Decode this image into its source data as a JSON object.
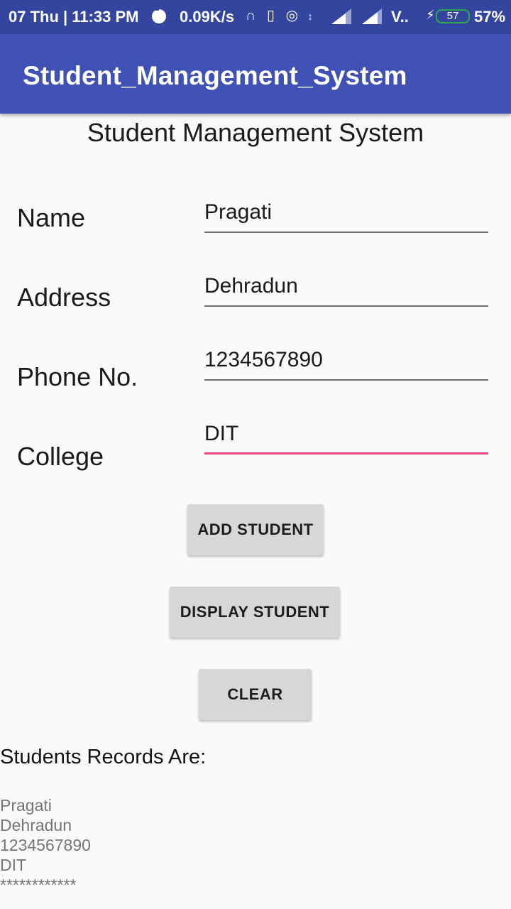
{
  "status_bar": {
    "time": "07 Thu | 11:33 PM",
    "net_speed": "0.09K/s",
    "carrier": "V..",
    "battery_level": "57",
    "battery_percent": "57%"
  },
  "app_bar": {
    "title": "Student_Management_System"
  },
  "form": {
    "heading": "Student Management System",
    "name_label": "Name",
    "name_value": "Pragati",
    "address_label": "Address",
    "address_value": "Dehradun",
    "phone_label": "Phone No.",
    "phone_value": "1234567890",
    "college_label": "College",
    "college_value": "DIT"
  },
  "buttons": {
    "add": "ADD STUDENT",
    "display": "DISPLAY STUDENT",
    "clear": "CLEAR"
  },
  "records": {
    "title": "Students Records Are:",
    "lines": [
      "Pragati",
      "Dehradun",
      "1234567890",
      "DIT",
      "************"
    ]
  },
  "colors": {
    "status_bar": "#3445a0",
    "app_bar": "#3f51b5",
    "accent": "#e8457e",
    "button": "#d6d7d7"
  }
}
